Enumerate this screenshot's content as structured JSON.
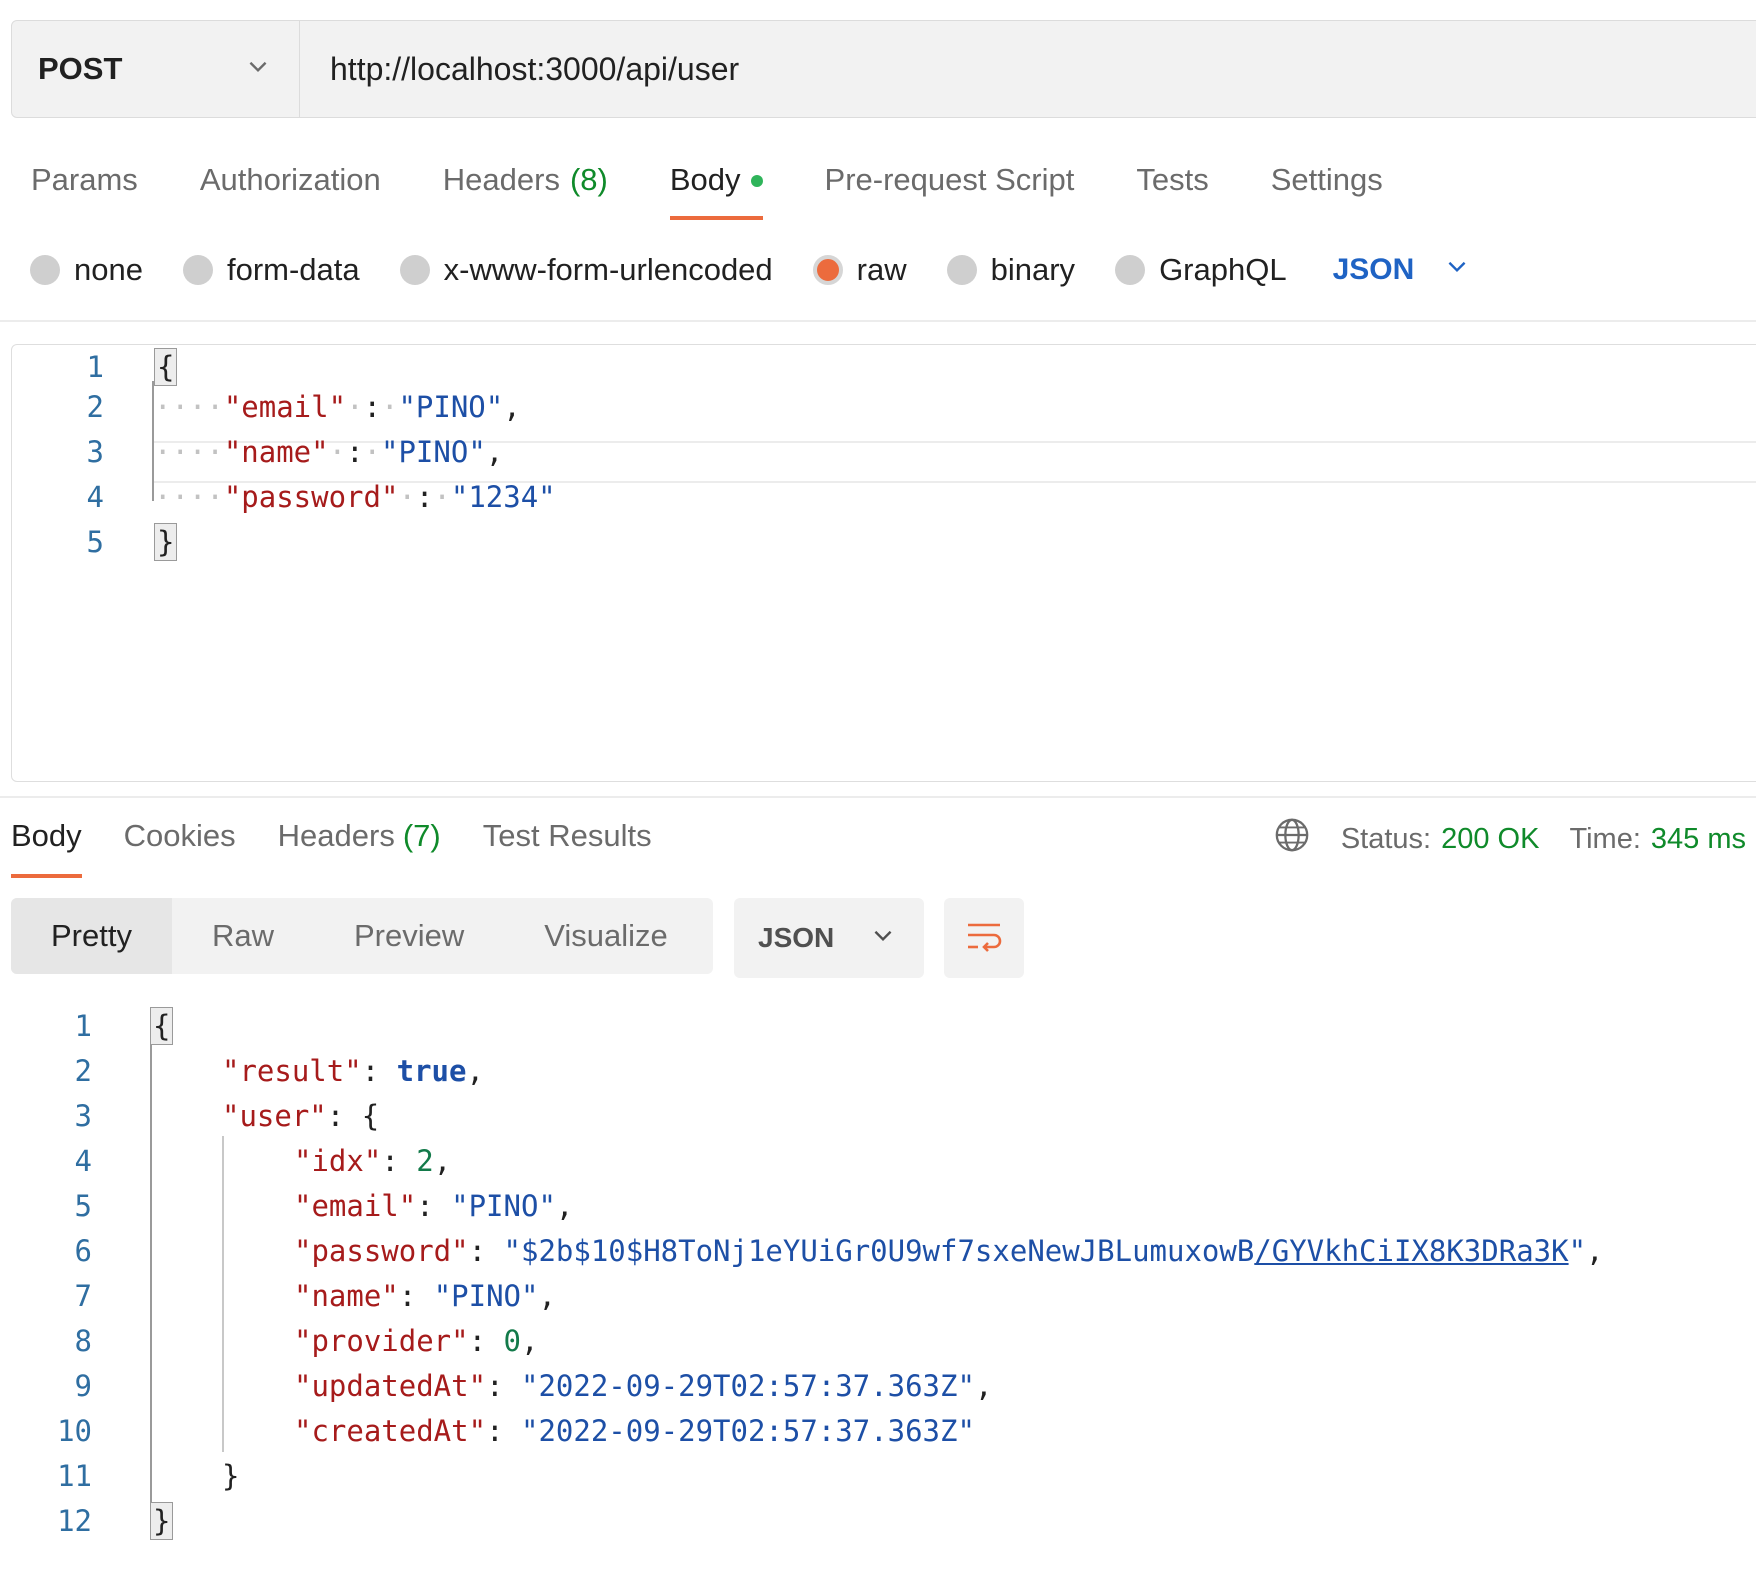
{
  "request": {
    "method": "POST",
    "url": "http://localhost:3000/api/user",
    "tabs": [
      {
        "label": "Params"
      },
      {
        "label": "Authorization"
      },
      {
        "label": "Headers",
        "count": "(8)"
      },
      {
        "label": "Body",
        "active": true
      },
      {
        "label": "Pre-request Script"
      },
      {
        "label": "Tests"
      },
      {
        "label": "Settings"
      }
    ],
    "body_types": [
      {
        "label": "none"
      },
      {
        "label": "form-data"
      },
      {
        "label": "x-www-form-urlencoded"
      },
      {
        "label": "raw",
        "selected": true
      },
      {
        "label": "binary"
      },
      {
        "label": "GraphQL"
      }
    ],
    "body_language": "JSON",
    "editor": {
      "line_numbers": [
        "1",
        "2",
        "3",
        "4",
        "5"
      ],
      "lines": [
        {
          "open": "{"
        },
        {
          "key": "\"email\"",
          "colon": ":",
          "value": "\"PINO\"",
          "comma": ","
        },
        {
          "key": "\"name\"",
          "colon": ":",
          "value": "\"PINO\"",
          "comma": ","
        },
        {
          "key": "\"password\"",
          "colon": ":",
          "value": "\"1234\""
        },
        {
          "close": "}"
        }
      ]
    }
  },
  "response": {
    "tabs": [
      {
        "label": "Body",
        "active": true
      },
      {
        "label": "Cookies"
      },
      {
        "label": "Headers",
        "count": "(7)"
      },
      {
        "label": "Test Results"
      }
    ],
    "status_label": "Status:",
    "status_value": "200 OK",
    "time_label": "Time:",
    "time_value": "345 ms",
    "view_modes": [
      "Pretty",
      "Raw",
      "Preview",
      "Visualize"
    ],
    "format": "JSON",
    "line_numbers": [
      "1",
      "2",
      "3",
      "4",
      "5",
      "6",
      "7",
      "8",
      "9",
      "10",
      "11",
      "12"
    ],
    "json": {
      "open": "{",
      "result_key": "\"result\"",
      "result_value": "true",
      "user_key": "\"user\"",
      "user_open": "{",
      "idx_key": "\"idx\"",
      "idx_value": "2",
      "email_key": "\"email\"",
      "email_value": "\"PINO\"",
      "password_key": "\"password\"",
      "password_value_a": "\"$2b$10$H8ToNj1eYUiGr0U9wf7sxeNewJBLumuxowB",
      "password_value_b": "/GYVkhCiIX8K3DRa3K",
      "password_value_c": "\"",
      "name_key": "\"name\"",
      "name_value": "\"PINO\"",
      "provider_key": "\"provider\"",
      "provider_value": "0",
      "updated_key": "\"updatedAt\"",
      "updated_value": "\"2022-09-29T02:57:37.363Z\"",
      "created_key": "\"createdAt\"",
      "created_value": "\"2022-09-29T02:57:37.363Z\"",
      "user_close": "}",
      "close": "}"
    }
  },
  "colors": {
    "accent": "#ec6b3d",
    "success": "#0f8a2a",
    "link_blue": "#1f63c4",
    "json_key": "#a61b1b",
    "json_string": "#1d4fa6"
  },
  "icons": [
    "chevron-down-icon",
    "globe-icon",
    "wrap-lines-icon"
  ]
}
